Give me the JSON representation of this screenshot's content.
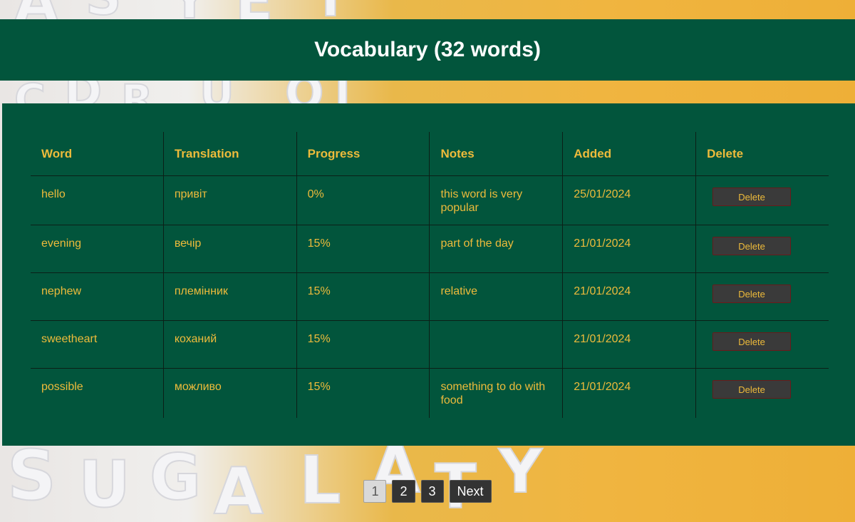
{
  "title": "Vocabulary (32 words)",
  "table": {
    "headers": {
      "word": "Word",
      "translation": "Translation",
      "progress": "Progress",
      "notes": "Notes",
      "added": "Added",
      "delete": "Delete"
    },
    "rows": [
      {
        "word": "hello",
        "translation": "привіт",
        "progress": "0%",
        "notes": "this word is very popular",
        "added": "25/01/2024",
        "delete_label": "Delete"
      },
      {
        "word": "evening",
        "translation": "вечір",
        "progress": "15%",
        "notes": "part of the day",
        "added": "21/01/2024",
        "delete_label": "Delete"
      },
      {
        "word": "nephew",
        "translation": "племінник",
        "progress": "15%",
        "notes": "relative",
        "added": "21/01/2024",
        "delete_label": "Delete"
      },
      {
        "word": "sweetheart",
        "translation": "коханий",
        "progress": "15%",
        "notes": "",
        "added": "21/01/2024",
        "delete_label": "Delete"
      },
      {
        "word": "possible",
        "translation": "можливо",
        "progress": "15%",
        "notes": "something to do with food",
        "added": "21/01/2024",
        "delete_label": "Delete"
      }
    ]
  },
  "pagination": {
    "pages": [
      "1",
      "2",
      "3"
    ],
    "current": "1",
    "next_label": "Next"
  },
  "colors": {
    "primary_green": "#02553c",
    "accent_yellow": "#eebb3b",
    "button_dark": "#333333"
  }
}
